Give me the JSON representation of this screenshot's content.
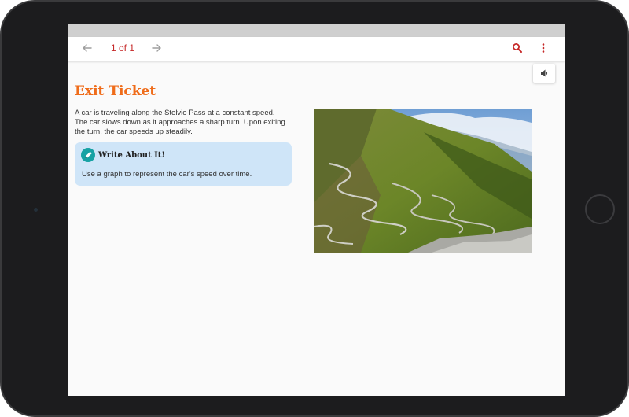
{
  "toolbar": {
    "page_indicator": "1 of 1",
    "prev_icon": "arrow-left-icon",
    "next_icon": "arrow-right-icon",
    "search_icon": "search-icon",
    "more_icon": "more-vertical-icon",
    "accent_color": "#c62828"
  },
  "audio": {
    "icon": "speaker-icon"
  },
  "content": {
    "title": "Exit Ticket",
    "title_color": "#ef6c1a",
    "paragraph_lines": [
      "A car is traveling along the Stelvio Pass at a constant speed.",
      "The car slows down as it approaches a sharp turn. Upon exiting",
      "the turn, the car speeds up steadily."
    ],
    "callout": {
      "heading": "Write About It!",
      "text": "Use a graph to represent the car's speed over time.",
      "icon": "pencil-icon",
      "background": "#cfe5f8",
      "icon_color": "#17a2a4"
    },
    "image": {
      "description_icon": "mountain-road-photo"
    }
  }
}
